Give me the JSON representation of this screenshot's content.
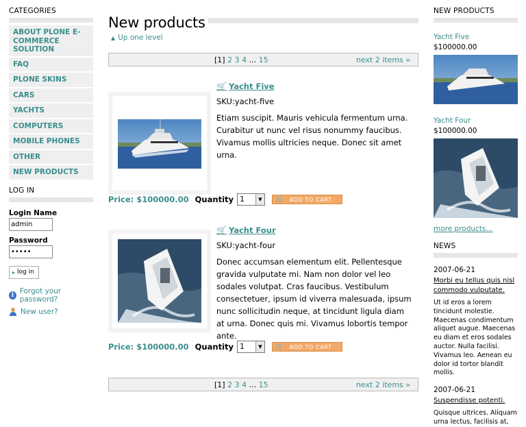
{
  "categories": {
    "header": "CATEGORIES",
    "items": [
      {
        "label": "ABOUT PLONE E-COMMERCE SOLUTION"
      },
      {
        "label": "FAQ"
      },
      {
        "label": "PLONE SKINS"
      },
      {
        "label": "CARS"
      },
      {
        "label": "YACHTS"
      },
      {
        "label": "COMPUTERS"
      },
      {
        "label": "MOBILE PHONES"
      },
      {
        "label": "OTHER"
      },
      {
        "label": "NEW PRODUCTS"
      }
    ]
  },
  "login": {
    "header": "LOG IN",
    "login_label": "Login Name",
    "login_value": "admin",
    "password_label": "Password",
    "password_value": "•••••",
    "button_label": "log in",
    "forgot_label": "Forgot your password?",
    "new_user_label": "New user?"
  },
  "main": {
    "title": "New products",
    "up_link": "Up one level",
    "pager": {
      "current": "[1]",
      "pages": [
        "2",
        "3",
        "4",
        "...",
        "15"
      ],
      "next": "next 2 items »"
    },
    "products": [
      {
        "title": "Yacht Five",
        "sku": "SKU:yacht-five",
        "description": "Etiam suscipit. Mauris vehicula fermentum urna. Curabitur ut nunc vel risus nonummy faucibus. Vivamus mollis ultricies neque. Donec sit amet urna.",
        "price": "Price: $100000.00",
        "quantity_label": "Quantity",
        "quantity_value": "1",
        "cart_label": "ADD TO CART"
      },
      {
        "title": "Yacht Four",
        "sku": "SKU:yacht-four",
        "description": "Donec accumsan elementum elit. Pellentesque gravida vulputate mi. Nam non dolor vel leo sodales volutpat. Cras faucibus. Vestibulum consectetuer, ipsum id viverra malesuada, ipsum nunc sollicitudin neque, at tincidunt ligula diam at urna. Donec quis mi. Vivamus lobortis tempor ante.",
        "price": "Price: $100000.00",
        "quantity_label": "Quantity",
        "quantity_value": "1",
        "cart_label": "ADD TO CART"
      }
    ]
  },
  "new_products": {
    "header": "NEW PRODUCTS",
    "items": [
      {
        "title": "Yacht Five",
        "price": "$100000.00"
      },
      {
        "title": "Yacht Four",
        "price": "$100000.00"
      }
    ],
    "more_label": "more products..."
  },
  "news": {
    "header": "NEWS",
    "items": [
      {
        "date": "2007-06-21",
        "title": "Morbi eu tellus quis nisl commodo vulputate.",
        "body": "Ut id eros a lorem tincidunt molestie. Maecenas condimentum aliquet augue. Maecenas eu diam et eros sodales auctor. Nulla facilisi. Vivamus leo. Aenean eu dolor id tortor blandit mollis."
      },
      {
        "date": "2007-06-21",
        "title": "Suspendisse potenti.",
        "body": "Quisque ultrices. Aliquam urna lectus, facilisis at,"
      }
    ]
  },
  "colors": {
    "link": "#3a8e8e",
    "header_bar": "#e6e6e6",
    "cart_button": "#f2a968"
  },
  "icons": {
    "cart": "shopping-cart-icon",
    "info": "info-icon",
    "user": "user-icon",
    "up": "caret-up-icon"
  }
}
